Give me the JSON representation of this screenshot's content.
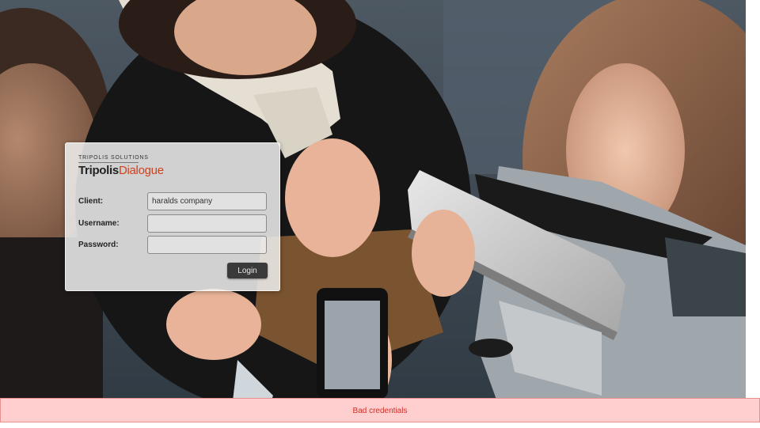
{
  "login": {
    "brand_small": "TRIPOLIS SOLUTIONS",
    "brand_primary": "Tripolis",
    "brand_accent": "Dialogue",
    "client_label": "Client:",
    "client_value": "haralds company",
    "username_label": "Username:",
    "username_value": "",
    "password_label": "Password:",
    "password_value": "",
    "login_button": "Login"
  },
  "error": {
    "message": "Bad credentials"
  },
  "colors": {
    "brand_accent": "#d2401c",
    "error_background": "#ffcece",
    "error_text": "#d0302a",
    "button_background": "#3a3a3a"
  }
}
